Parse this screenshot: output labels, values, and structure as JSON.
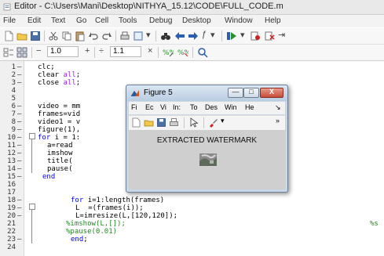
{
  "window": {
    "title": "Editor - C:\\Users\\Mani\\Desktop\\NITHYA_15.12\\CODE\\FULL_CODE.m"
  },
  "menu": {
    "items": [
      "File",
      "Edit",
      "Text",
      "Go",
      "Cell",
      "Tools",
      "Debug",
      "Desktop",
      "Window",
      "Help"
    ]
  },
  "cell_toolbar": {
    "field1": "1.0",
    "field2": "1.1",
    "minus": "−",
    "plus": "+",
    "divide": "÷",
    "times": "×"
  },
  "code_lines": [
    {
      "n": "1",
      "dash": "—",
      "segs": [
        {
          "t": "clc;",
          "c": ""
        }
      ]
    },
    {
      "n": "2",
      "dash": "—",
      "segs": [
        {
          "t": "clear ",
          "c": ""
        },
        {
          "t": "all",
          "c": "str"
        },
        {
          "t": ";",
          "c": ""
        }
      ]
    },
    {
      "n": "3",
      "dash": "—",
      "segs": [
        {
          "t": "close ",
          "c": ""
        },
        {
          "t": "all",
          "c": "str"
        },
        {
          "t": ";",
          "c": ""
        }
      ]
    },
    {
      "n": "4",
      "dash": "",
      "segs": []
    },
    {
      "n": "5",
      "dash": "",
      "segs": []
    },
    {
      "n": "6",
      "dash": "—",
      "segs": [
        {
          "t": "video = mm",
          "c": ""
        }
      ]
    },
    {
      "n": "7",
      "dash": "—",
      "segs": [
        {
          "t": "frames=vid",
          "c": ""
        }
      ]
    },
    {
      "n": "8",
      "dash": "—",
      "segs": [
        {
          "t": "video1 = v",
          "c": ""
        }
      ]
    },
    {
      "n": "9",
      "dash": "—",
      "segs": [
        {
          "t": "figure(1),",
          "c": ""
        }
      ]
    },
    {
      "n": "10",
      "dash": "—",
      "segs": [
        {
          "t": "for ",
          "c": "kw"
        },
        {
          "t": "i = 1:",
          "c": ""
        }
      ]
    },
    {
      "n": "11",
      "dash": "—",
      "segs": [
        {
          "t": "a=read",
          "c": ""
        }
      ]
    },
    {
      "n": "12",
      "dash": "—",
      "segs": [
        {
          "t": "imshow",
          "c": ""
        }
      ]
    },
    {
      "n": "13",
      "dash": "—",
      "segs": [
        {
          "t": "title(",
          "c": ""
        }
      ]
    },
    {
      "n": "14",
      "dash": "—",
      "segs": [
        {
          "t": "pause(",
          "c": ""
        }
      ]
    },
    {
      "n": "15",
      "dash": "—",
      "segs": [
        {
          "t": "end",
          "c": "kw"
        }
      ]
    },
    {
      "n": "16",
      "dash": "",
      "segs": []
    },
    {
      "n": "17",
      "dash": "",
      "segs": []
    },
    {
      "n": "18",
      "dash": "—",
      "segs": [
        {
          "t": "for ",
          "c": "kw"
        },
        {
          "t": "i=1:length(frames)",
          "c": ""
        }
      ]
    },
    {
      "n": "19",
      "dash": "—",
      "segs": [
        {
          "t": "L  =(frames(i));",
          "c": ""
        }
      ]
    },
    {
      "n": "20",
      "dash": "—",
      "segs": [
        {
          "t": "L=imresize(L,[120,120]);",
          "c": ""
        }
      ]
    },
    {
      "n": "21",
      "dash": "",
      "segs": [
        {
          "t": "%",
          "c": "cm"
        },
        {
          "t": "imshow(L,[]);",
          "c": "cm"
        }
      ]
    },
    {
      "n": "22",
      "dash": "",
      "segs": [
        {
          "t": "%",
          "c": "cm"
        },
        {
          "t": "pause(0.01)",
          "c": "cm"
        }
      ]
    },
    {
      "n": "23",
      "dash": "—",
      "segs": [
        {
          "t": "end",
          "c": "kw"
        },
        {
          "t": ";",
          "c": ""
        }
      ]
    },
    {
      "n": "24",
      "dash": "",
      "segs": []
    }
  ],
  "line20_tail": "%s",
  "figure": {
    "title": "Figure 5",
    "menu_items": [
      "Fi",
      "Ec",
      "Vi",
      "In:",
      "To",
      "Des",
      "Win",
      "He",
      "↘"
    ],
    "toolbar_overflow": "»",
    "axes_title": "EXTRACTED WATERMARK",
    "buttons": {
      "minimize": "—",
      "maximize": "□",
      "close": "X"
    }
  },
  "icons": {
    "app": "matlab-editor-icon",
    "figure": "matlab-logo-icon"
  },
  "colors": {
    "keyword": "#0000ff",
    "string": "#a020f0",
    "comment": "#228b22"
  }
}
